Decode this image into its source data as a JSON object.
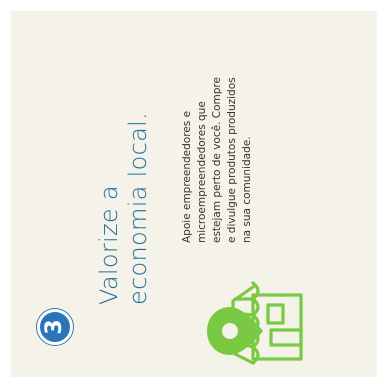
{
  "step": {
    "number": "3"
  },
  "heading": {
    "line1": "Valorize a",
    "line2": "economia local."
  },
  "description": {
    "line1": "Apoie empreendedores e",
    "line2": "microempreendedores que",
    "line3": "estejam perto de você. Compre",
    "line4": "e divulgue produtos produzidos",
    "line5": "na sua comunidade."
  },
  "icon": {
    "name": "local-shop-location-icon"
  },
  "colors": {
    "background": "#f4f2e9",
    "accent_green": "#7ac943",
    "badge_blue": "#2a74b9",
    "title_blue": "#1f6f95",
    "text": "#333333"
  }
}
